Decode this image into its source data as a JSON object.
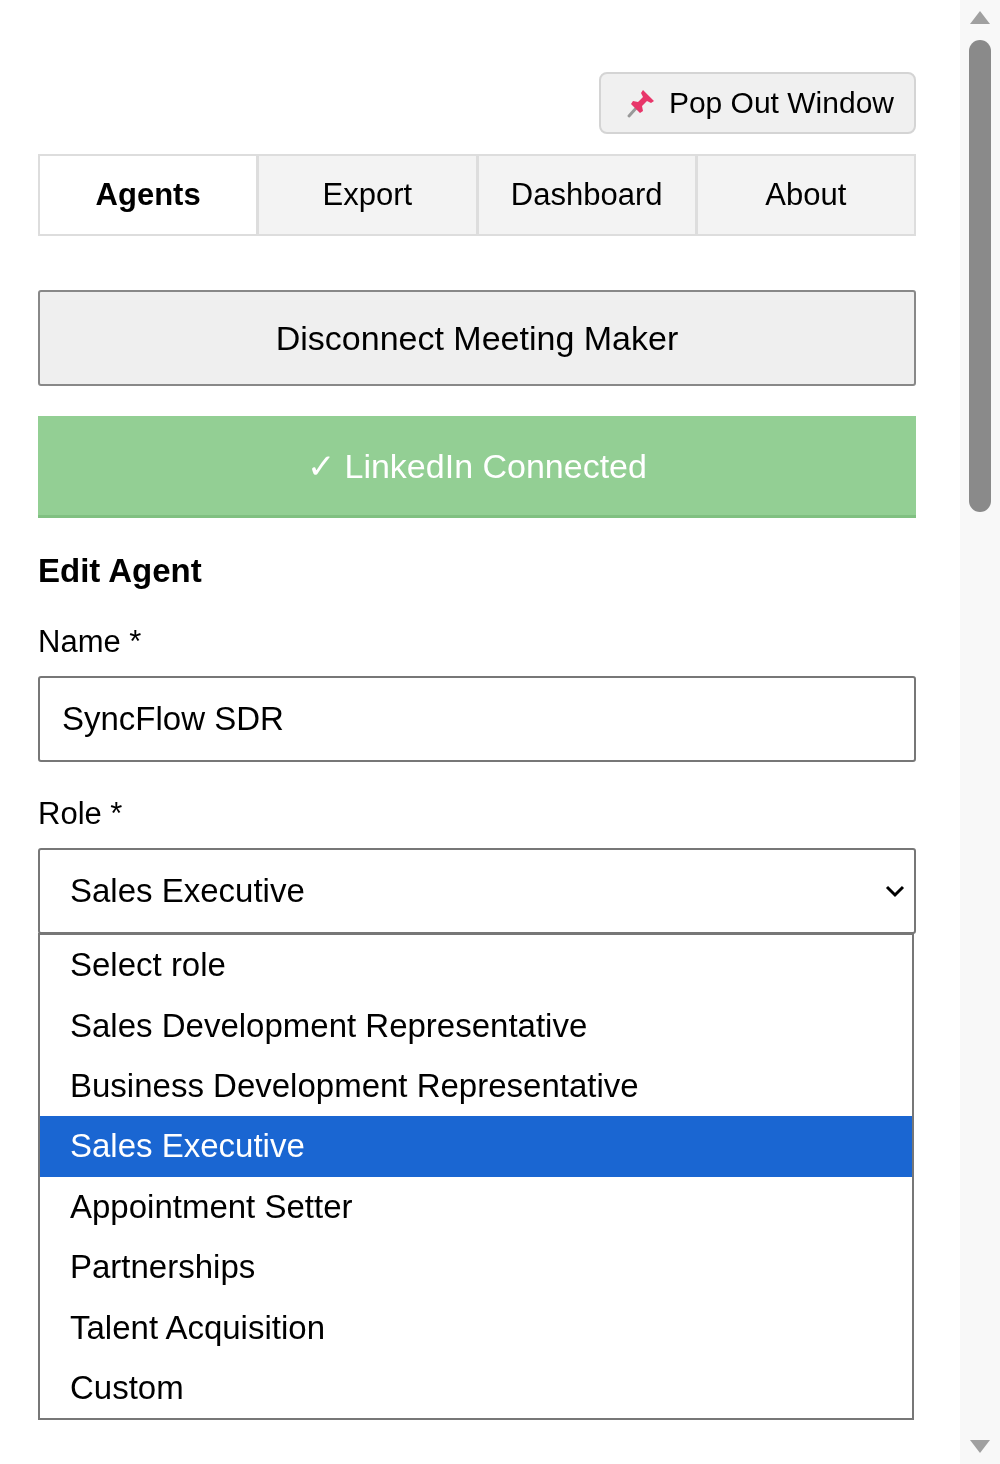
{
  "pop_out_button": {
    "label": "Pop Out Window"
  },
  "tabs": [
    {
      "label": "Agents",
      "selected": true
    },
    {
      "label": "Export",
      "selected": false
    },
    {
      "label": "Dashboard",
      "selected": false
    },
    {
      "label": "About",
      "selected": false
    }
  ],
  "disconnect_button": {
    "label": "Disconnect Meeting Maker"
  },
  "linkedin_status": {
    "label": "✓ LinkedIn Connected"
  },
  "section_title": "Edit Agent",
  "name_field": {
    "label": "Name *",
    "value": "SyncFlow SDR"
  },
  "role_field": {
    "label": "Role *",
    "value": "Sales Executive",
    "expanded": true,
    "options": [
      {
        "label": "Select role",
        "selected": false
      },
      {
        "label": "Sales Development Representative",
        "selected": false
      },
      {
        "label": "Business Development Representative",
        "selected": false
      },
      {
        "label": "Sales Executive",
        "selected": true
      },
      {
        "label": "Appointment Setter",
        "selected": false
      },
      {
        "label": "Partnerships",
        "selected": false
      },
      {
        "label": "Talent Acquisition",
        "selected": false
      },
      {
        "label": "Custom",
        "selected": false
      }
    ]
  }
}
